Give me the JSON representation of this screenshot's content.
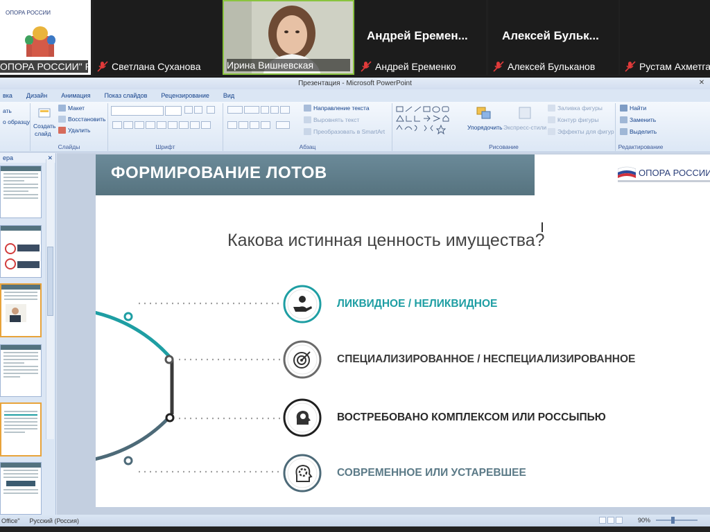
{
  "video_tiles": [
    {
      "name": "ОПОРА РОССИИ\" Р...",
      "logo_text": "ОПОРА РОССИИ",
      "muted": false
    },
    {
      "name": "Светлана Суханова",
      "muted": true
    },
    {
      "name": "Ирина Вишневская",
      "muted": false,
      "active": true
    },
    {
      "name": "Андрей Еременко",
      "big_name": "Андрей Еремен...",
      "muted": true
    },
    {
      "name": "Алексей Бульканов",
      "big_name": "Алексей Бульк...",
      "muted": true
    },
    {
      "name": "Рустам Ахметга",
      "muted": true
    }
  ],
  "window": {
    "title": "Презентация - Microsoft PowerPoint",
    "close": "✕"
  },
  "ribbon_tabs": [
    "вка",
    "Дизайн",
    "Анимация",
    "Показ слайдов",
    "Рецензирование",
    "Вид"
  ],
  "ribbon": {
    "slides": {
      "create_line1": "Создать",
      "create_line2": "слайд",
      "layout": "Макет",
      "reset": "Восстановить",
      "delete": "Удалить",
      "left1": "ать",
      "left2": "о образцу",
      "label": "Слайды"
    },
    "font": {
      "label": "Шрифт"
    },
    "paragraph": {
      "text_direction": "Направление текста",
      "align_text": "Выровнять текст",
      "smartart": "Преобразовать в SmartArt",
      "label": "Абзац"
    },
    "drawing": {
      "arrange": "Упорядочить",
      "quick_styles": "Экспресс-стили",
      "fill": "Заливка фигуры",
      "outline": "Контур фигуры",
      "effects": "Эффекты для фигур",
      "label": "Рисование"
    },
    "editing": {
      "find": "Найти",
      "replace": "Заменить",
      "select": "Выделить",
      "label": "Редактирование"
    }
  },
  "sidebar": {
    "header": "ера",
    "close": "✕"
  },
  "slide": {
    "title": "ФОРМИРОВАНИЕ ЛОТОВ",
    "logo": "ОПОРА РОССИИ",
    "question": "Какова истинная ценность имущества?",
    "items": [
      {
        "text": "ЛИКВИДНОЕ / НЕЛИКВИДНОЕ",
        "color": "#1e9ea3",
        "icon": "money-hand-icon"
      },
      {
        "text": "СПЕЦИАЛИЗИРОВАННОЕ / НЕСПЕЦИАЛИЗИРОВАННОЕ",
        "color": "#3a3a3a",
        "icon": "target-icon"
      },
      {
        "text": "ВОСТРЕБОВАНО КОМПЛЕКСОМ ИЛИ РОССЫПЬЮ",
        "color": "#2a2a2a",
        "icon": "idea-head-icon"
      },
      {
        "text": "СОВРЕМЕННОЕ ИЛИ УСТАРЕВШЕЕ",
        "color": "#5b7a87",
        "icon": "gear-head-icon"
      }
    ]
  },
  "statusbar": {
    "theme": "Office\"",
    "language": "Русский (Россия)",
    "zoom": "90%"
  }
}
